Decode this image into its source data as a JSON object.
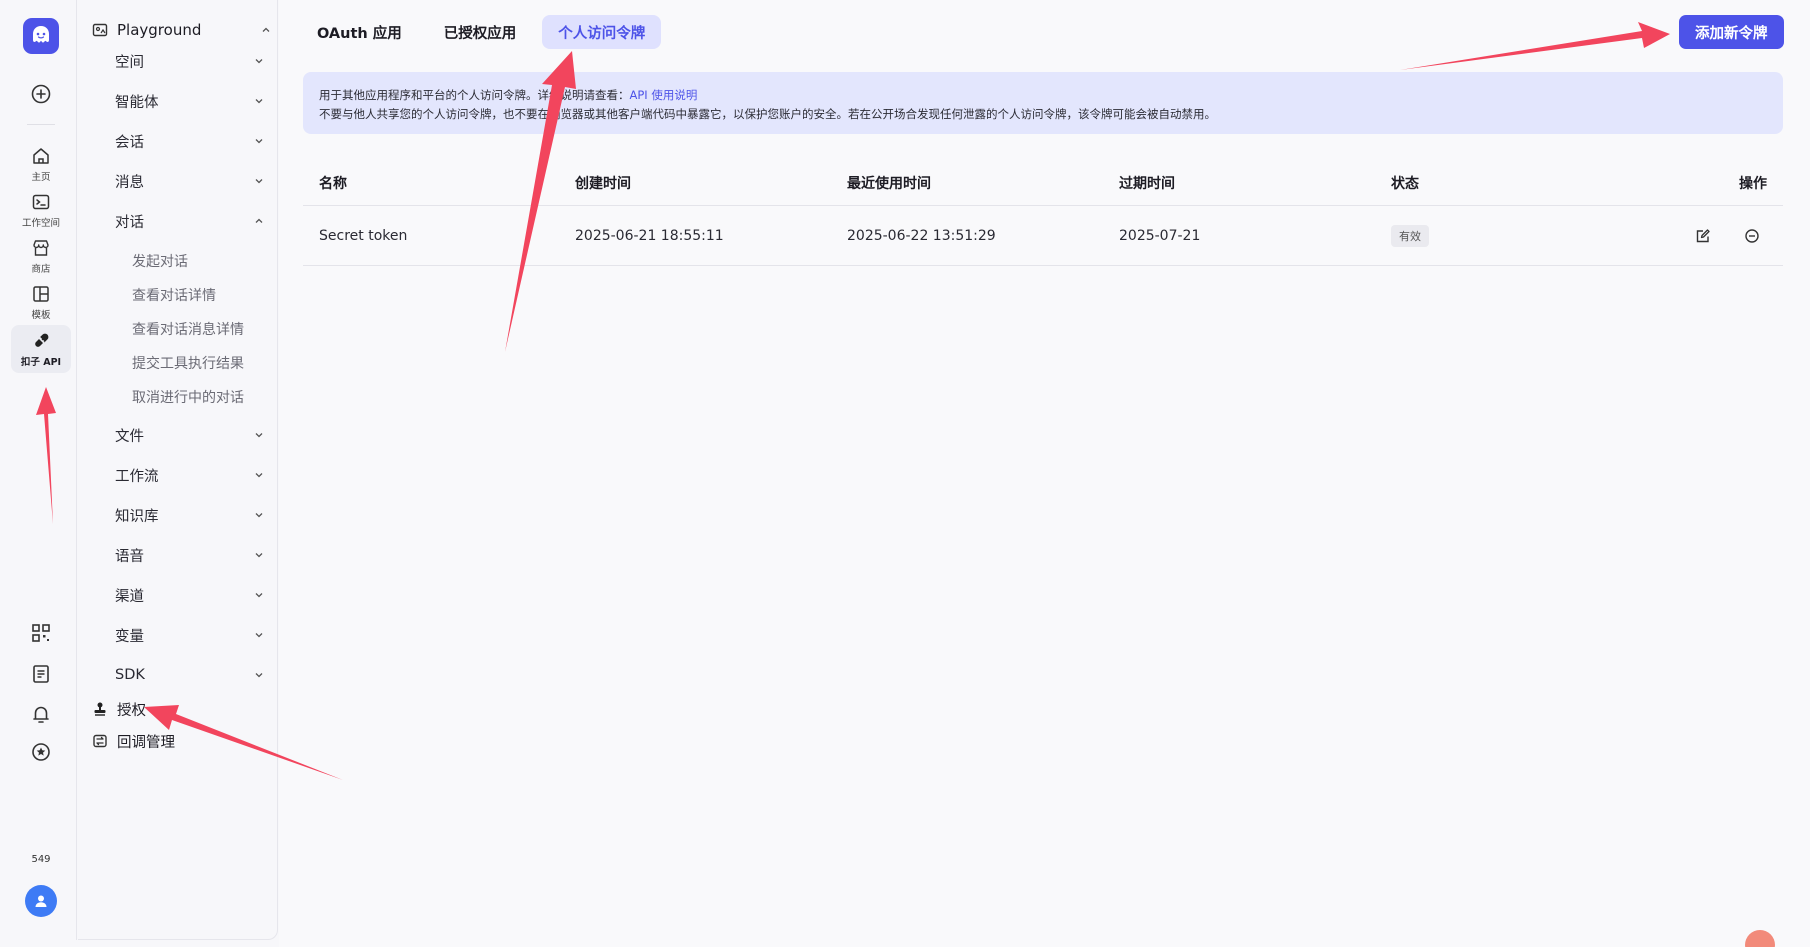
{
  "rail": {
    "items": [
      {
        "label": "主页",
        "icon": "home-icon"
      },
      {
        "label": "工作空间",
        "icon": "terminal-icon"
      },
      {
        "label": "商店",
        "icon": "store-icon"
      },
      {
        "label": "模板",
        "icon": "template-icon"
      },
      {
        "label": "扣子 API",
        "icon": "plug-icon",
        "active": true
      }
    ],
    "count": "549"
  },
  "nav": {
    "header": "Playground",
    "sections": [
      {
        "label": "空间"
      },
      {
        "label": "智能体"
      },
      {
        "label": "会话"
      },
      {
        "label": "消息"
      },
      {
        "label": "对话",
        "expanded": true
      }
    ],
    "dialog_items": [
      "发起对话",
      "查看对话详情",
      "查看对话消息详情",
      "提交工具执行结果",
      "取消进行中的对话"
    ],
    "sections_after": [
      {
        "label": "文件"
      },
      {
        "label": "工作流"
      },
      {
        "label": "知识库"
      },
      {
        "label": "语音"
      },
      {
        "label": "渠道"
      },
      {
        "label": "变量"
      },
      {
        "label": "SDK"
      }
    ],
    "leaves": [
      {
        "label": "授权",
        "icon": "stamp-icon"
      },
      {
        "label": "回调管理",
        "icon": "callback-icon"
      }
    ]
  },
  "tabs": [
    {
      "label": "OAuth 应用"
    },
    {
      "label": "已授权应用"
    },
    {
      "label": "个人访问令牌",
      "active": true
    }
  ],
  "add_button": "添加新令牌",
  "banner": {
    "line1_prefix": "用于其他应用程序和平台的个人访问令牌。详细说明请查看：",
    "link": "API 使用说明",
    "line2": "不要与他人共享您的个人访问令牌，也不要在浏览器或其他客户端代码中暴露它，以保护您账户的安全。若在公开场合发现任何泄露的个人访问令牌，该令牌可能会被自动禁用。"
  },
  "table": {
    "headers": [
      "名称",
      "创建时间",
      "最近使用时间",
      "过期时间",
      "状态",
      "操作"
    ],
    "rows": [
      {
        "name": "Secret token",
        "created": "2025-06-21 18:55:11",
        "last_used": "2025-06-22 13:51:29",
        "expires": "2025-07-21",
        "status": "有效"
      }
    ]
  },
  "colors": {
    "accent": "#4d53e8",
    "arrow": "#f2455d",
    "banner_bg": "#e3e6fd"
  }
}
